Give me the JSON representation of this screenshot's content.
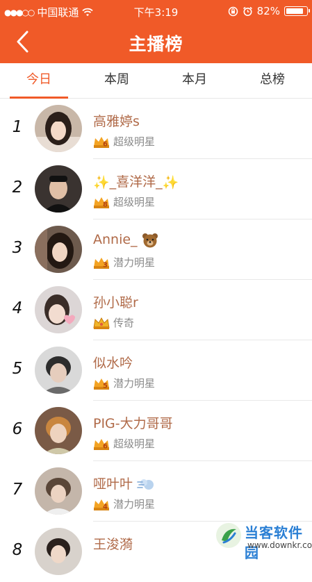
{
  "status": {
    "carrier": "中国联通",
    "time": "下午3:19",
    "battery": "82%",
    "signal_icon": "signal-dots-icon",
    "wifi_icon": "wifi-icon"
  },
  "header": {
    "title": "主播榜",
    "back_icon": "chevron-left-icon",
    "background_color": "#f05a28"
  },
  "tabs": [
    {
      "label": "今日",
      "active": true
    },
    {
      "label": "本周",
      "active": false
    },
    {
      "label": "本月",
      "active": false
    },
    {
      "label": "总榜",
      "active": false
    }
  ],
  "accent_color": "#f05a28",
  "ranking": [
    {
      "rank": "1",
      "name": "高雅婷s",
      "badge_level": "6",
      "level": "超级明星"
    },
    {
      "rank": "2",
      "name": "_喜洋洋_",
      "badge_level": "8",
      "level": "超级明星"
    },
    {
      "rank": "3",
      "name": "Annie_",
      "badge_level": "3",
      "level": "潜力明星"
    },
    {
      "rank": "4",
      "name": "孙小聪r",
      "badge_level": "",
      "level": "传奇"
    },
    {
      "rank": "5",
      "name": "似水吟",
      "badge_level": "5",
      "level": "潜力明星"
    },
    {
      "rank": "6",
      "name": "PIG-大力哥哥",
      "badge_level": "6",
      "level": "超级明星"
    },
    {
      "rank": "7",
      "name": "哑叶叶",
      "badge_level": "4",
      "level": "潜力明星"
    },
    {
      "rank": "8",
      "name": "王浚漪",
      "badge_level": "",
      "level": ""
    }
  ],
  "watermark": {
    "title": "当客软件园",
    "url": "www.downkr.com"
  }
}
